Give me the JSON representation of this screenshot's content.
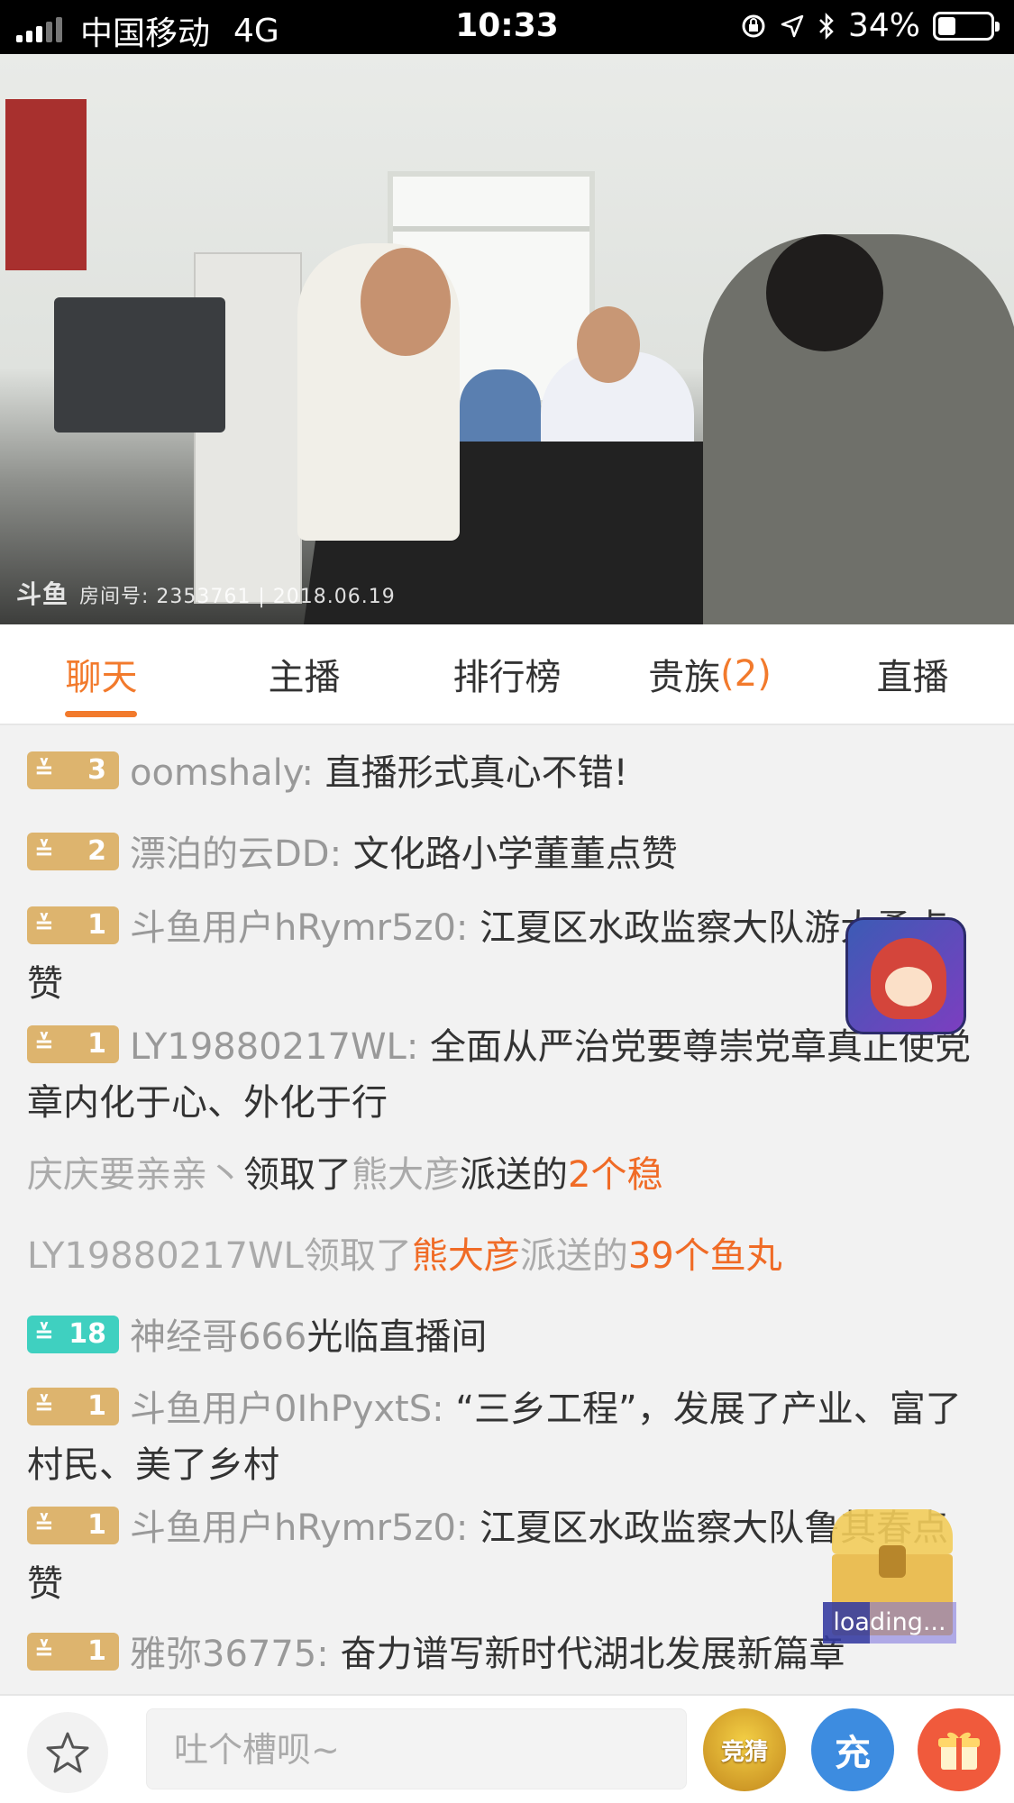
{
  "status_bar": {
    "carrier": "中国移动",
    "network": "4G",
    "time": "10:33",
    "battery_percent": "34%",
    "battery_level": 0.34
  },
  "video": {
    "watermark_logo": "斗鱼",
    "watermark_text": "房间号: 2353761 | 2018.06.19"
  },
  "tabs": [
    {
      "label": "聊天",
      "active": true
    },
    {
      "label": "主播"
    },
    {
      "label": "排行榜"
    },
    {
      "label": "贵族",
      "count": "(2)"
    },
    {
      "label": "直播"
    }
  ],
  "chat": {
    "messages": [
      {
        "level": "3",
        "user": "oomshaly:",
        "text": " 直播形式真心不错!"
      },
      {
        "level": "2",
        "user": "漂泊的云DD:",
        "text": " 文化路小学董董点赞"
      },
      {
        "level": "1",
        "user": "斗鱼用户hRymr5z0:",
        "text": " 江夏区水政监察大队游大勇点赞"
      },
      {
        "level": "1",
        "user": "LY19880217WL:",
        "text": " 全面从严治党要尊崇党章真正使党章内化于心、外化于行"
      },
      {
        "type": "system",
        "p1": "庆庆要亲亲丶",
        "p2": "领取了",
        "p3": "熊大彦",
        "p4": "派送的",
        "p5": "2个稳"
      },
      {
        "type": "system",
        "p1": "LY19880217WL",
        "p2": "领取了",
        "p3": "熊大彦",
        "p4": "派送的",
        "p5": "39个鱼丸"
      },
      {
        "level": "18",
        "user": "神经哥666",
        "text": "光临直播间"
      },
      {
        "level": "1",
        "user": "斗鱼用户0IhPyxtS:",
        "text": " “三乡工程”，发展了产业、富了村民、美了乡村"
      },
      {
        "level": "1",
        "user": "斗鱼用户hRymr5z0:",
        "text": " 江夏区水政监察大队鲁其春点赞"
      },
      {
        "level": "1",
        "user": "雅弥36775:",
        "text": " 奋力谱写新时代湖北发展新篇章"
      }
    ]
  },
  "overlay": {
    "loading_text": "loading..."
  },
  "bottom_bar": {
    "input_placeholder": "吐个槽呗~",
    "guess_label": "竞猜",
    "charge_label": "充"
  },
  "colors": {
    "accent": "#f27a2c",
    "badge_gold": "#ddb46e",
    "badge_teal": "#3fd0c0",
    "charge_blue": "#3d8ce0",
    "gift_red": "#f05a3c"
  },
  "icons": [
    "signal-icon",
    "orientation-lock-icon",
    "location-arrow-icon",
    "bluetooth-icon",
    "battery-icon",
    "emoji-icon",
    "gift-icon",
    "treasure-chest-icon",
    "game-avatar-icon"
  ]
}
